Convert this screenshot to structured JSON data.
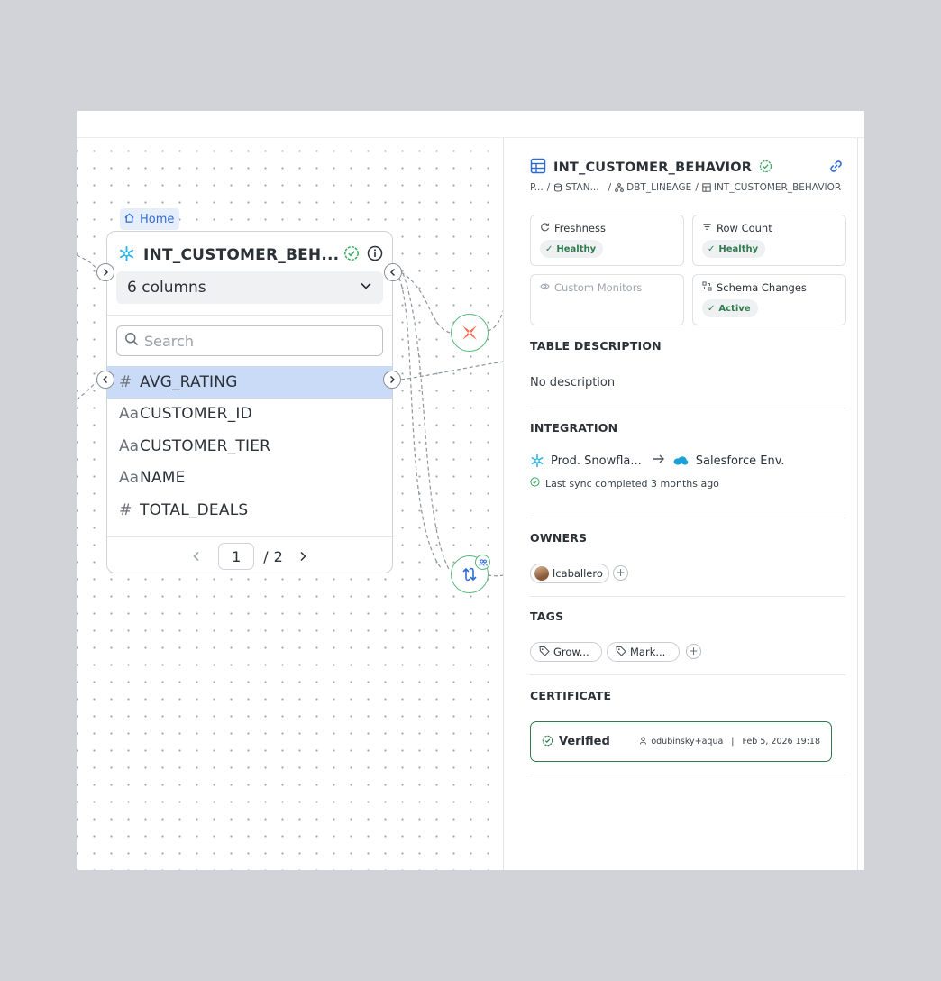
{
  "lineage": {
    "home_label": "Home",
    "table_card": {
      "title": "INT_CUSTOMER_BEH...",
      "columns_select": "6 columns",
      "search_placeholder": "Search",
      "columns": [
        {
          "type": "numeric",
          "type_glyph": "#",
          "name": "AVG_RATING",
          "selected": true
        },
        {
          "type": "text",
          "type_glyph": "Aa",
          "name": "CUSTOMER_ID",
          "selected": false
        },
        {
          "type": "text",
          "type_glyph": "Aa",
          "name": "CUSTOMER_TIER",
          "selected": false
        },
        {
          "type": "text",
          "type_glyph": "Aa",
          "name": "NAME",
          "selected": false
        },
        {
          "type": "numeric",
          "type_glyph": "#",
          "name": "TOTAL_DEALS",
          "selected": false
        }
      ],
      "pagination": {
        "current": "1",
        "separator": "/",
        "total": "2"
      }
    }
  },
  "panel": {
    "title": "INT_CUSTOMER_BEHAVIOR",
    "breadcrumb": [
      "P...",
      "STAN...",
      "DBT_LINEAGE",
      "INT_CUSTOMER_BEHAVIOR"
    ],
    "metrics": [
      {
        "label": "Freshness",
        "status": "Healthy",
        "icon": "refresh-icon"
      },
      {
        "label": "Row Count",
        "status": "Healthy",
        "icon": "filter-icon"
      },
      {
        "label": "Custom Monitors",
        "status": "",
        "icon": "eye-icon"
      },
      {
        "label": "Schema Changes",
        "status": "Active",
        "icon": "schema-icon"
      }
    ],
    "description": {
      "heading": "TABLE DESCRIPTION",
      "text": "No description"
    },
    "integration": {
      "heading": "INTEGRATION",
      "source": "Prod. Snowfla...",
      "destination": "Salesforce Env.",
      "sync_status": "Last sync completed 3 months ago"
    },
    "owners": {
      "heading": "OWNERS",
      "items": [
        "lcaballero"
      ]
    },
    "tags": {
      "heading": "TAGS",
      "items": [
        "Grow...",
        "Mark..."
      ]
    },
    "certificate": {
      "heading": "CERTIFICATE",
      "label": "Verified",
      "user": "odubinsky+aqua",
      "date": "Feb 5, 2026 19:18"
    }
  },
  "colors": {
    "accent_blue": "#2f6bd6",
    "success_green": "#2f7d4f",
    "selected_row": "#c9dbf7",
    "snowflake_blue": "#29b5e8",
    "dbt_orange": "#ff694a"
  }
}
